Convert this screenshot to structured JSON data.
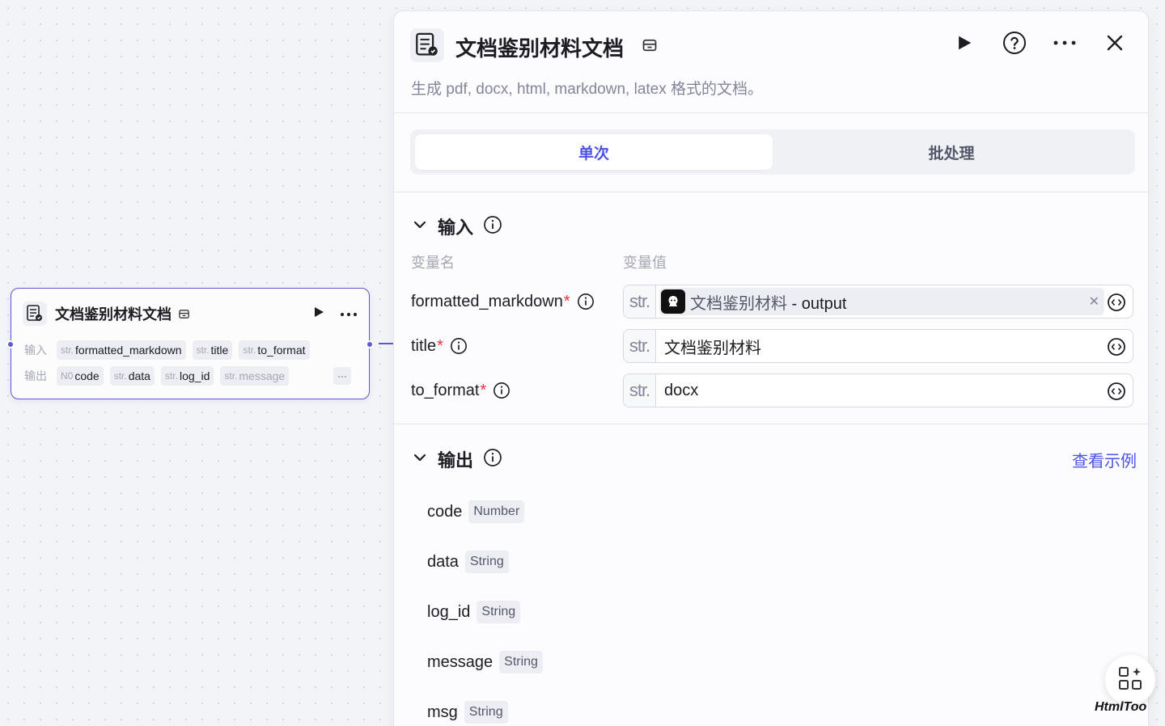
{
  "node": {
    "title": "文档鉴别材料文档",
    "input_label": "输入",
    "output_label": "输出",
    "inputs": [
      {
        "type": "str.",
        "name": "formatted_markdown"
      },
      {
        "type": "str.",
        "name": "title"
      },
      {
        "type": "str.",
        "name": "to_format"
      }
    ],
    "outputs": [
      {
        "type": "N0",
        "name": "code"
      },
      {
        "type": "str.",
        "name": "data"
      },
      {
        "type": "str.",
        "name": "log_id"
      },
      {
        "type": "str.",
        "name": "message"
      }
    ],
    "more_label": "···"
  },
  "panel": {
    "title": "文档鉴别材料文档",
    "description": "生成 pdf, docx, html, markdown, latex 格式的文档。",
    "tabs": [
      {
        "label": "单次",
        "active": true
      },
      {
        "label": "批处理",
        "active": false
      }
    ],
    "input_section": {
      "title": "输入",
      "col_name": "变量名",
      "col_value": "变量值",
      "params": [
        {
          "name": "formatted_markdown",
          "required_mark": "*",
          "type": "str.",
          "ref_source": "文档鉴别材料",
          "ref_sep": " - ",
          "ref_field": "output"
        },
        {
          "name": "title",
          "required_mark": "*",
          "type": "str.",
          "value": "文档鉴别材料"
        },
        {
          "name": "to_format",
          "required_mark": "*",
          "type": "str.",
          "value": "docx"
        }
      ]
    },
    "output_section": {
      "title": "输出",
      "view_example": "查看示例",
      "fields": [
        {
          "name": "code",
          "type": "Number"
        },
        {
          "name": "data",
          "type": "String"
        },
        {
          "name": "log_id",
          "type": "String"
        },
        {
          "name": "message",
          "type": "String"
        },
        {
          "name": "msg",
          "type": "String"
        }
      ]
    }
  },
  "watermark": "HtmlToo",
  "colors": {
    "accent": "#4d53e8",
    "node_border": "#5a58d6",
    "required": "#e53241"
  }
}
